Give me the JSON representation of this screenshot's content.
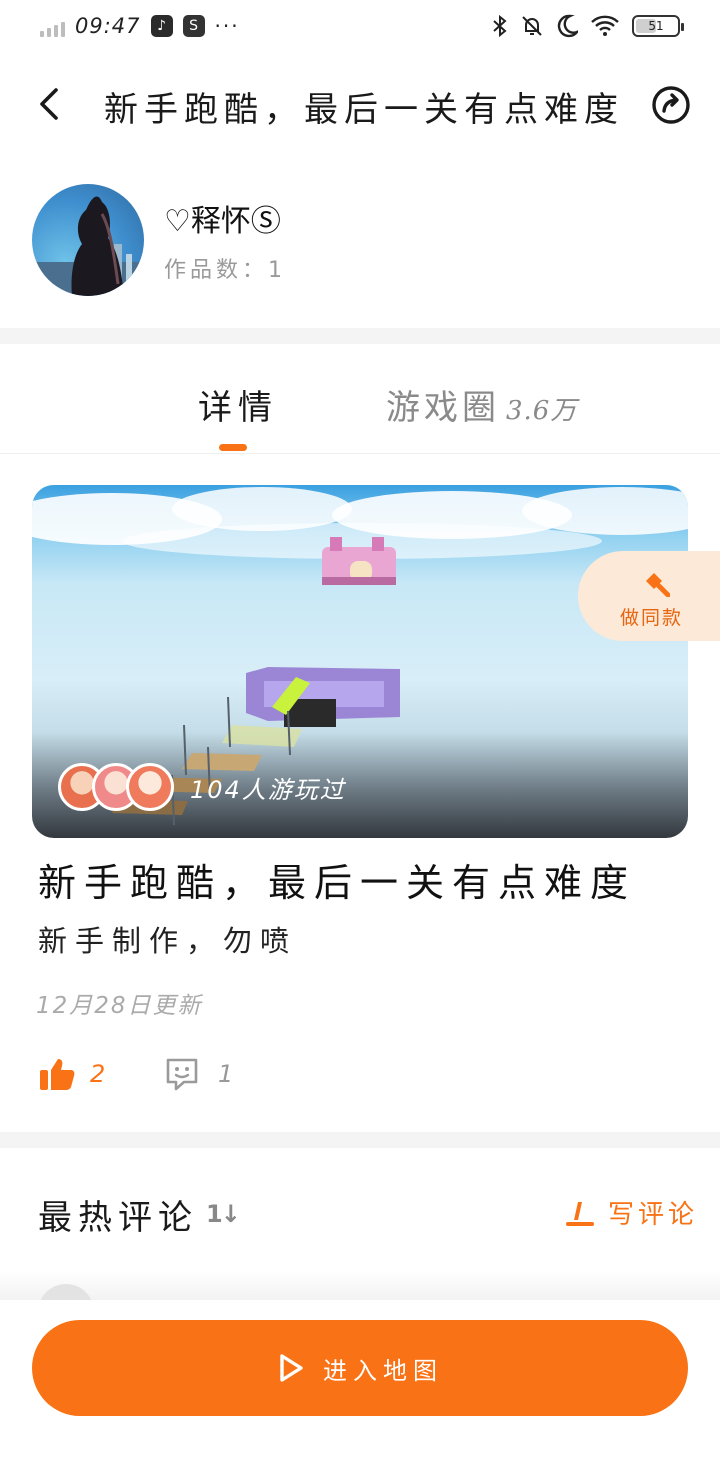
{
  "status_bar": {
    "time": "09:47",
    "app_icon_1": "tiktok-icon",
    "app_icon_2": "s-app-icon",
    "more": "···",
    "battery_level": "51",
    "battery_fraction": 0.51,
    "icons": [
      "bluetooth-icon",
      "mute-bell-icon",
      "moon-icon",
      "wifi-icon",
      "battery-icon"
    ]
  },
  "header": {
    "title": "新手跑酷，最后一关有点难度",
    "back_icon": "chevron-left-icon",
    "share_icon": "share-icon"
  },
  "author": {
    "name": "♡释怀Ⓢ",
    "works_label": "作品数：1"
  },
  "tabs": [
    {
      "label": "详情",
      "active": true
    },
    {
      "label": "游戏圈",
      "count": "3.6万",
      "active": false
    }
  ],
  "media": {
    "played_text": "104人游玩过",
    "make_same_label": "做同款"
  },
  "detail": {
    "title": "新手跑酷，最后一关有点难度",
    "description": "新手制作，勿喷",
    "updated": "12月28日更新",
    "likes": "2",
    "comments": "1"
  },
  "comments_section": {
    "title": "最热评论",
    "sort_glyph": "1↓",
    "write_label": "写评论"
  },
  "bottom": {
    "enter_label": "进入地图"
  },
  "colors": {
    "accent": "#f97316",
    "accent_light": "#fde9d8",
    "muted": "#9a9a9a"
  }
}
